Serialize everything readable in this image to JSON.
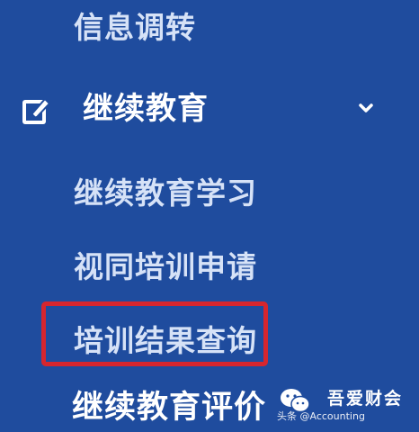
{
  "menu": {
    "item_info_transfer": "信息调转",
    "continuing_education": {
      "label": "继续教育",
      "icon": "edit-icon",
      "expanded_icon": "chevron-down-icon",
      "children": [
        "继续教育学习",
        "视同培训申请",
        "培训结果查询",
        "继续教育评价"
      ]
    }
  },
  "watermark": {
    "brand": "吾爱财会",
    "credit": "头条 @Accounting",
    "logo_icon": "wechat-logo"
  },
  "colors": {
    "background": "#1f4c9e",
    "highlight": "#d6262e"
  }
}
